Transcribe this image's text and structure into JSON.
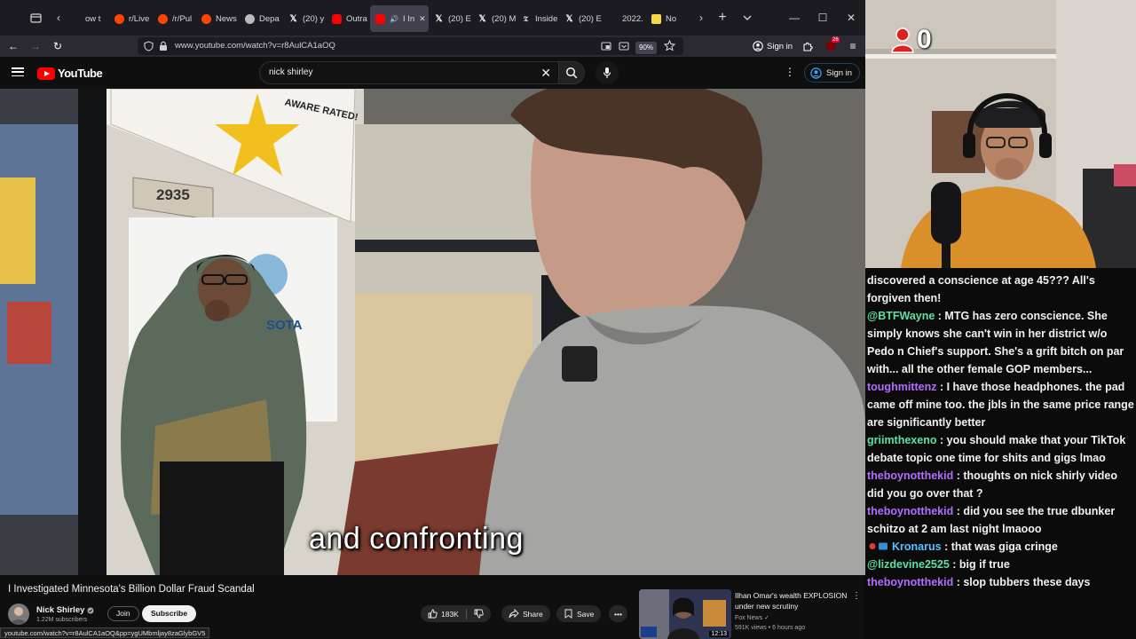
{
  "browser": {
    "tabs": [
      {
        "icon": "blank",
        "label": "ow t"
      },
      {
        "icon": "reddit",
        "label": "r/Live"
      },
      {
        "icon": "reddit",
        "label": "/r/Pul"
      },
      {
        "icon": "reddit",
        "label": "News"
      },
      {
        "icon": "gh",
        "label": "Depa"
      },
      {
        "icon": "x",
        "label": "(20) y"
      },
      {
        "icon": "yt",
        "label": "Outra"
      },
      {
        "icon": "yt",
        "label": "I In"
      },
      {
        "icon": "x",
        "label": "(20) E"
      },
      {
        "icon": "x",
        "label": "(20) M"
      },
      {
        "icon": "nyt",
        "label": "Inside"
      },
      {
        "icon": "x",
        "label": "(20) E"
      },
      {
        "icon": "blank",
        "label": "2022."
      },
      {
        "icon": "note",
        "label": "No"
      }
    ],
    "active_tab_index": 7,
    "url": "www.youtube.com/watch?v=r8AulCA1aOQ",
    "zoom": "90%",
    "signin_label": "Sign in",
    "extension_badge": "28"
  },
  "youtube": {
    "logo_text": "YouTube",
    "search_value": "nick shirley",
    "signin_label": "Sign in",
    "caption": "and confronting",
    "video_title": "I Investigated Minnesota's Billion Dollar Fraud Scandal",
    "channel_name": "Nick Shirley",
    "channel_subs": "1.22M subscribers",
    "join_label": "Join",
    "subscribe_label": "Subscribe",
    "like_count": "183K",
    "share_label": "Share",
    "save_label": "Save",
    "status_url": "youtube.com/watch?v=r8AulCA1aOQ&pp=ygUMbmljay8zaGlybGV5",
    "poster_text": "AWARE RATED!",
    "door_number": "2935",
    "sign_text": "SOTA"
  },
  "recommendation": {
    "title": "Ilhan Omar's wealth EXPLOSION under new scrutiny",
    "channel": "Fox News",
    "meta": "591K views • 6 hours ago",
    "duration": "12:13"
  },
  "stream": {
    "counter_value": "0"
  },
  "chat": [
    {
      "user": "",
      "color": "#ffffff",
      "text": "discovered a conscience at age 45??? All's forgiven then!"
    },
    {
      "user": "@BTFWayne",
      "color": "#5ce1a1",
      "text": ": MTG has zero conscience. She simply knows she can't win in her district w/o Pedo n Chief's support. She's a grift bitch on par with... all the other female GOP members..."
    },
    {
      "user": "toughmittenz",
      "color": "#b36cff",
      "text": ": I have those headphones. the pad came off mine too. the jbls in the same price range are significantly better"
    },
    {
      "user": "griimthexeno",
      "color": "#5ce1a1",
      "text": ": you should make that your TikTok debate topic one time for shits and gigs lmao"
    },
    {
      "user": "theboynotthekid",
      "color": "#b36cff",
      "text": ": thoughts on nick shirly video did you go over that ?"
    },
    {
      "user": "theboynotthekid",
      "color": "#b36cff",
      "text": ": did you see the true dbunker schitzo at 2 am last night lmaooo"
    },
    {
      "user": "Kronarus",
      "color": "#56c2ff",
      "text": ": that was giga cringe",
      "badges": true
    },
    {
      "user": "@lizdevine2525",
      "color": "#5ce1a1",
      "text": ": big if true"
    },
    {
      "user": "theboynotthekid",
      "color": "#b36cff",
      "text": ": slop tubbers these days"
    }
  ]
}
